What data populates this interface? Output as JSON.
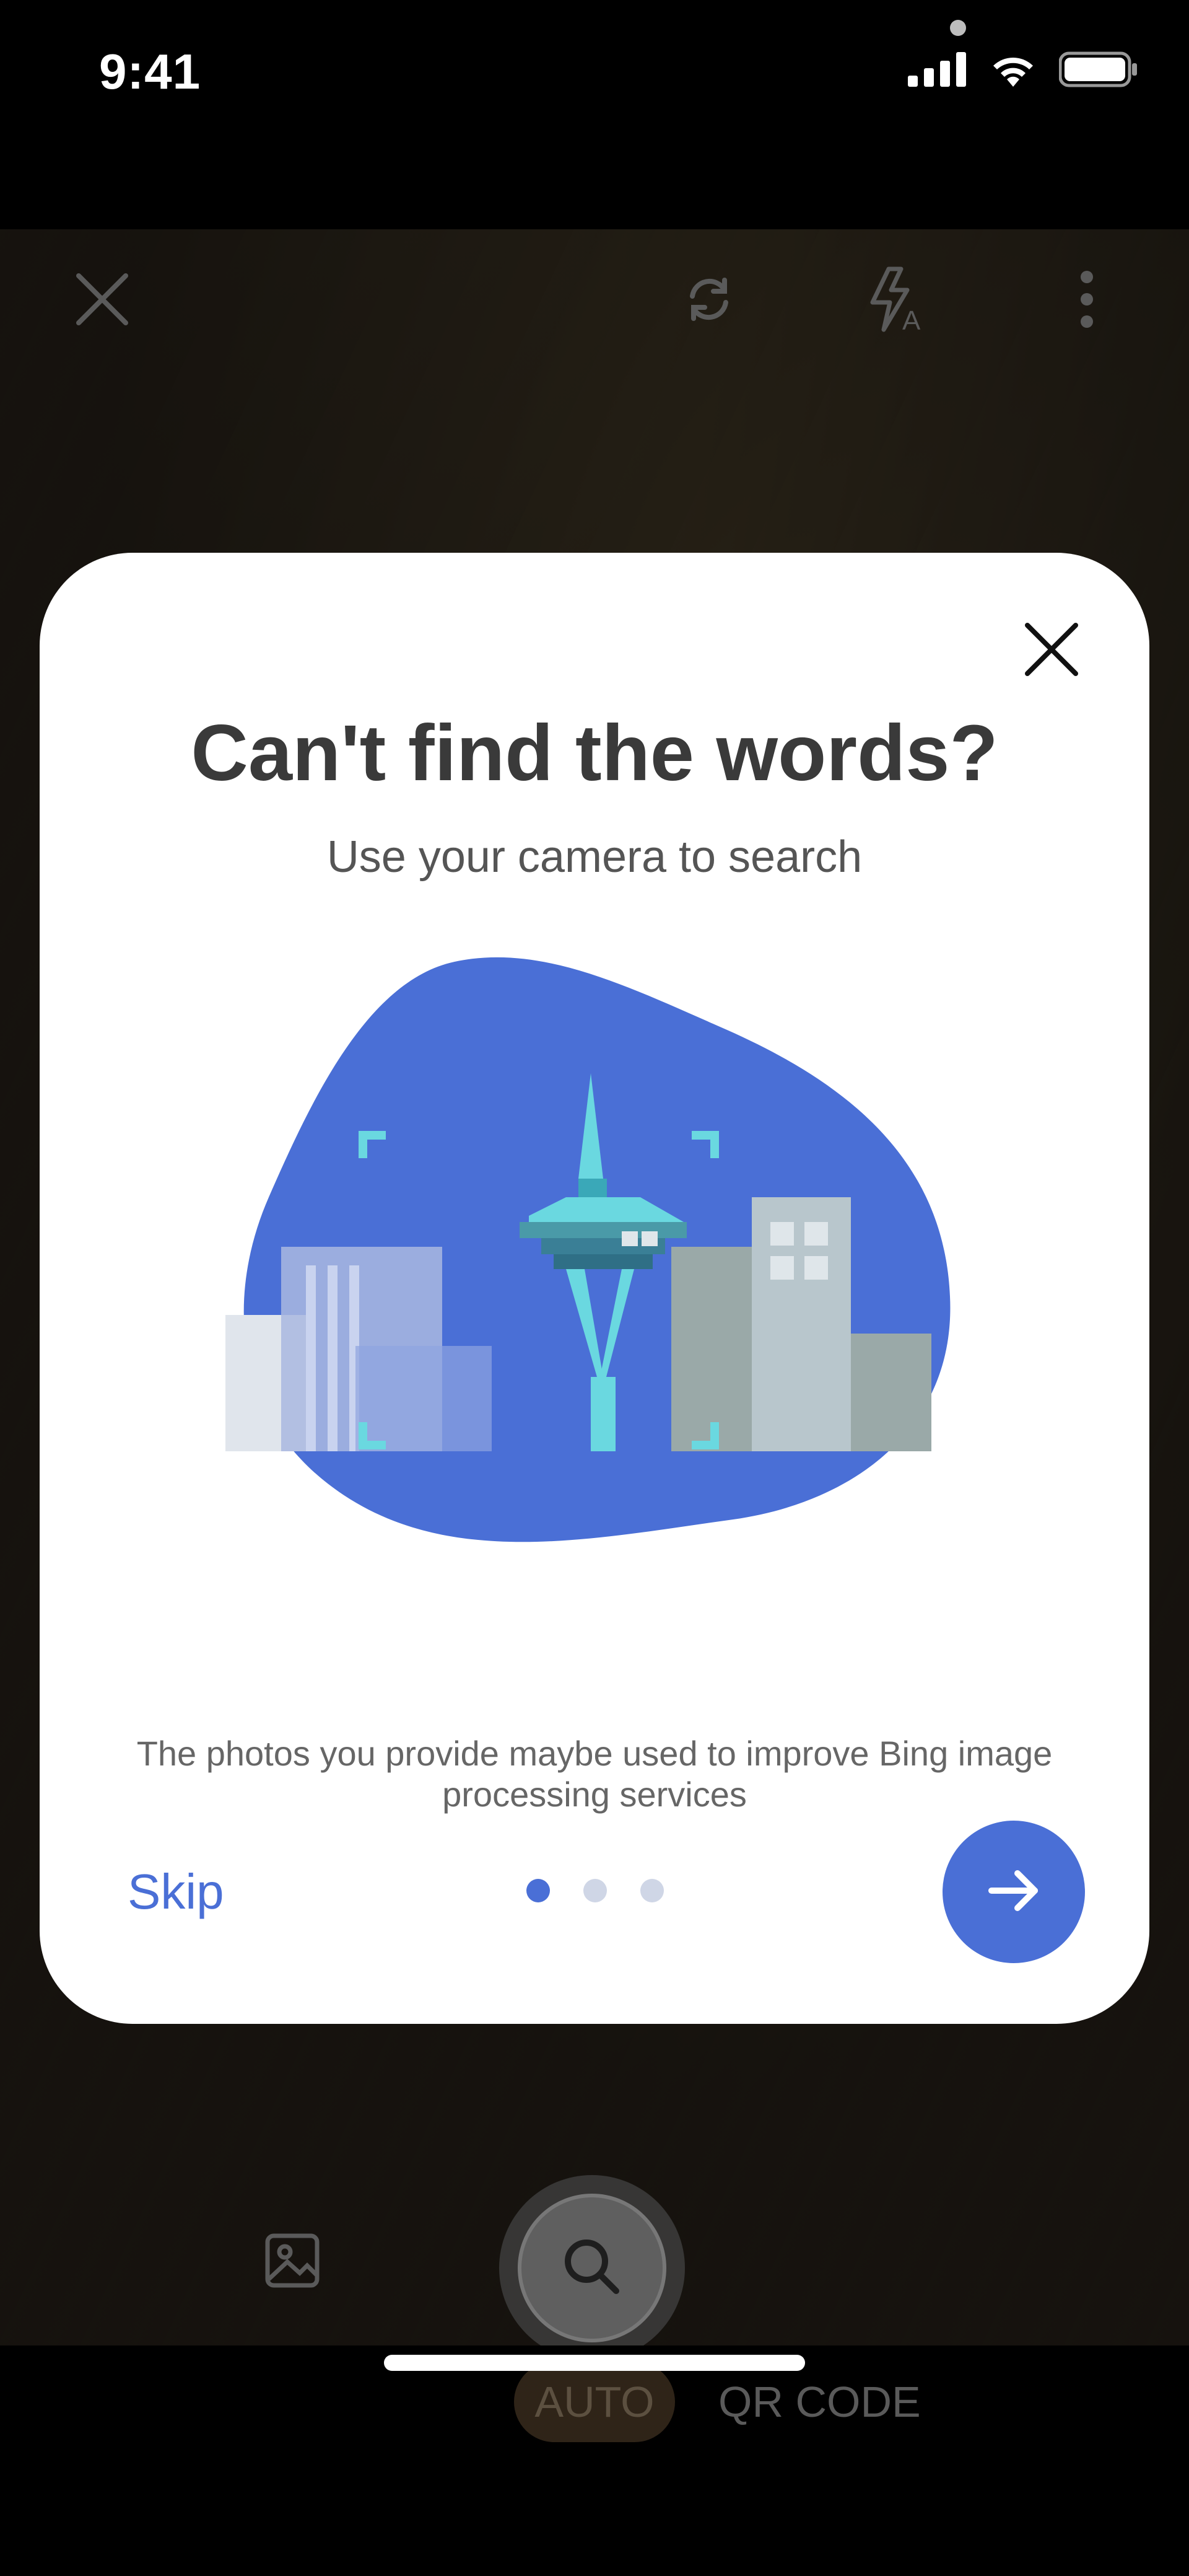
{
  "status_bar": {
    "time": "9:41",
    "icons": [
      "signal-icon",
      "wifi-icon",
      "battery-icon"
    ]
  },
  "camera": {
    "top_controls": [
      "close-icon",
      "flip-camera-icon",
      "flash-auto-icon",
      "more-icon"
    ],
    "bottom_controls": [
      "gallery-icon",
      "search-icon"
    ],
    "modes": [
      {
        "label": "AUTO",
        "selected": true
      },
      {
        "label": "QR CODE",
        "selected": false
      }
    ]
  },
  "onboarding": {
    "title": "Can't find the words?",
    "subtitle": "Use your camera to search",
    "disclaimer": "The photos you provide maybe used to improve Bing image processing services",
    "skip_label": "Skip",
    "page_index": 1,
    "page_count": 3,
    "next_icon": "arrow-right-icon",
    "close_icon": "close-icon",
    "accent_color": "#4a6fd6"
  }
}
